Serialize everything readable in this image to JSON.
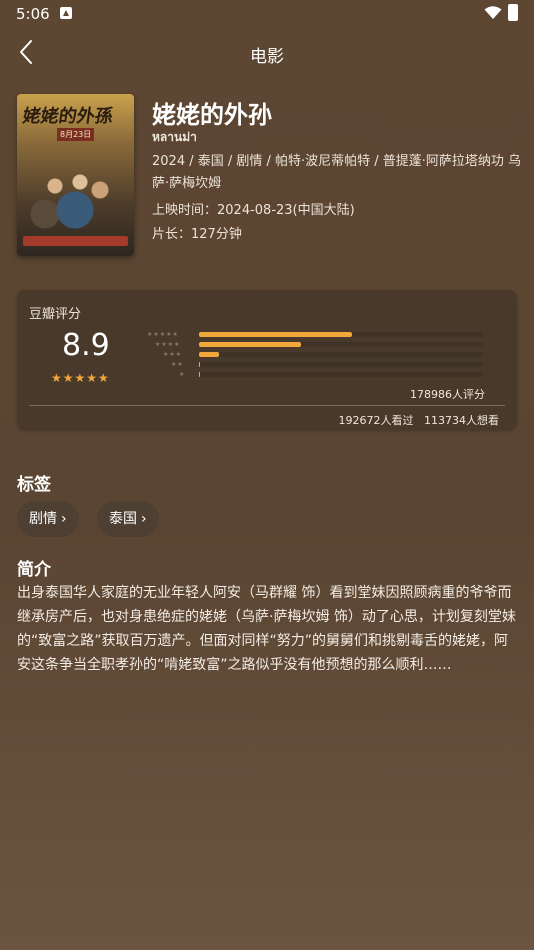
{
  "status_bar": {
    "time": "5:06"
  },
  "header": {
    "title": "电影"
  },
  "movie": {
    "title": "姥姥的外孙",
    "original_title": "หลานม่า",
    "meta": "2024 / 泰国 / 剧情 / 帕特·波尼蒂帕特 / 普提蓬·阿萨拉塔纳功 乌萨·萨梅坎姆",
    "release": "上映时间：2024-08-23(中国大陆)",
    "duration": "片长：127分钟",
    "poster": {
      "title_text": "姥姥的外孫",
      "date_text": "8月23日"
    }
  },
  "rating": {
    "label": "豆瓣评分",
    "score": "8.9",
    "stars_display": "★★★★★",
    "distribution": [
      {
        "stars": 5,
        "fraction": 0.54
      },
      {
        "stars": 4,
        "fraction": 0.36
      },
      {
        "stars": 3,
        "fraction": 0.07
      },
      {
        "stars": 2,
        "fraction": 0.005
      },
      {
        "stars": 1,
        "fraction": 0.003
      }
    ],
    "rating_count": "178986人评分",
    "watched": "192672人看过",
    "wish": "113734人想看"
  },
  "tags": {
    "title": "标签",
    "items": [
      {
        "label": "剧情"
      },
      {
        "label": "泰国"
      }
    ]
  },
  "intro": {
    "title": "简介",
    "text": "出身泰国华人家庭的无业年轻人阿安（马群耀 饰）看到堂妹因照顾病重的爷爷而继承房产后，也对身患绝症的姥姥（乌萨·萨梅坎姆 饰）动了心思，计划复刻堂妹的“致富之路”获取百万遗产。但面对同样“努力”的舅舅们和挑剔毒舌的姥姥，阿安这条争当全职孝孙的“啃姥致富”之路似乎没有他预想的那么顺利……"
  },
  "colors": {
    "accent": "#f1a73b",
    "background": "#5d4733"
  }
}
